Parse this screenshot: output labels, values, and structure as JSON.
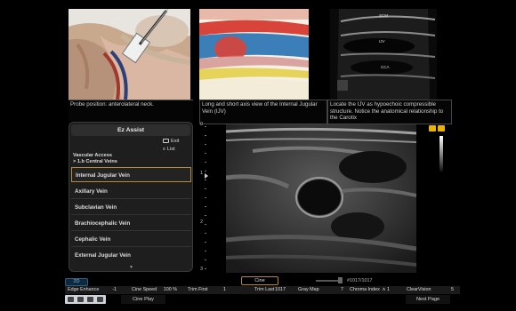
{
  "reference": {
    "panel1_caption": "Probe position: anterolateral neck.",
    "panel2_caption": "Long and short axis view of the Internal Jugular Vein (IJV)",
    "panel3_caption": "Locate the IJV as hypoechoic compressible structure. Notice the anatomical relationship to the Carotix",
    "panel3_labels": [
      "SCM",
      "IJV",
      "CCA"
    ]
  },
  "ez_assist": {
    "title": "Ez Assist",
    "exit_label": "Exit",
    "list_label": "List",
    "breadcrumb_line1": "Vascular Access",
    "breadcrumb_line2": "> 1.b Central Veins",
    "items": [
      "Internal Jugular Vein",
      "Axillary Vein",
      "Subclavian Vein",
      "Brachiocephalic Vein",
      "Cephalic Vein",
      "External Jugular Vein"
    ],
    "active_index": 0
  },
  "depth_scale": [
    "0",
    "1",
    "2",
    "3"
  ],
  "cine": {
    "button_label": "Cine",
    "frame_counter": "#1017/1017"
  },
  "mode_tab": "2D",
  "params": [
    {
      "label": "Edge Enhance",
      "value": "-1"
    },
    {
      "label": "Cine Speed",
      "value": "100 %"
    },
    {
      "label": "Trim First",
      "value": "1"
    },
    {
      "label": "Trim Last",
      "value": "1017"
    },
    {
      "label": "Gray Map",
      "value": "7"
    },
    {
      "label": "Chroma Index",
      "value": "∧ 1"
    },
    {
      "label": "ClearVision",
      "value": "5"
    }
  ],
  "buttons": {
    "cine_play": "Cine Play",
    "next_page": "Next Page"
  },
  "colors": {
    "accent_border": "#b58a3a",
    "icon_yellow": "#e9b300",
    "tab_blue": "#7fb6dd"
  },
  "icons": [
    "exit-icon",
    "list-icon",
    "scroll-down-icon",
    "lock-icon",
    "settings-icon",
    "focus-marker-icon"
  ]
}
